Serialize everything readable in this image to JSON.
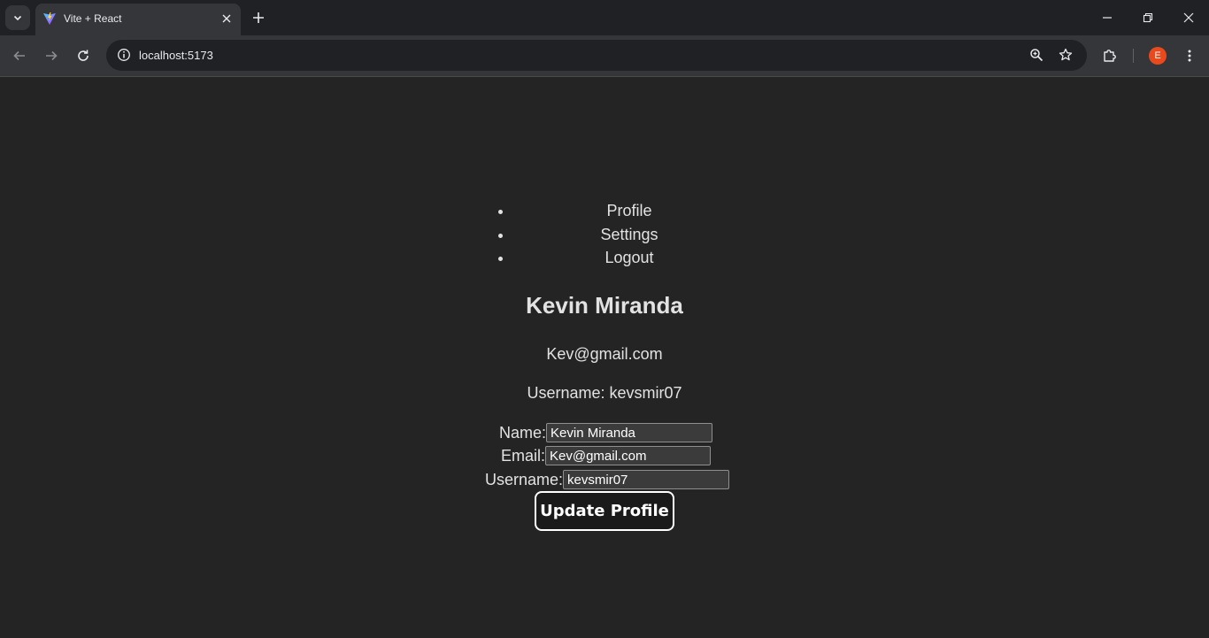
{
  "browser": {
    "tab": {
      "title": "Vite + React"
    },
    "address": {
      "url": "localhost:5173"
    },
    "profile_initial": "E"
  },
  "nav": {
    "items": [
      {
        "label": "Profile"
      },
      {
        "label": "Settings"
      },
      {
        "label": "Logout"
      }
    ]
  },
  "profile": {
    "name": "Kevin Miranda",
    "email": "Kev@gmail.com",
    "username_line": "Username: kevsmir07"
  },
  "form": {
    "name_label": "Name:",
    "name_value": "Kevin Miranda",
    "email_label": "Email:",
    "email_value": "Kev@gmail.com",
    "username_label": "Username:",
    "username_value": "kevsmir07",
    "submit_label": "Update Profile"
  },
  "colors": {
    "page_bg": "#242424",
    "chrome_bg": "#202124",
    "toolbar_bg": "#35363a",
    "avatar": "#e8491d"
  }
}
